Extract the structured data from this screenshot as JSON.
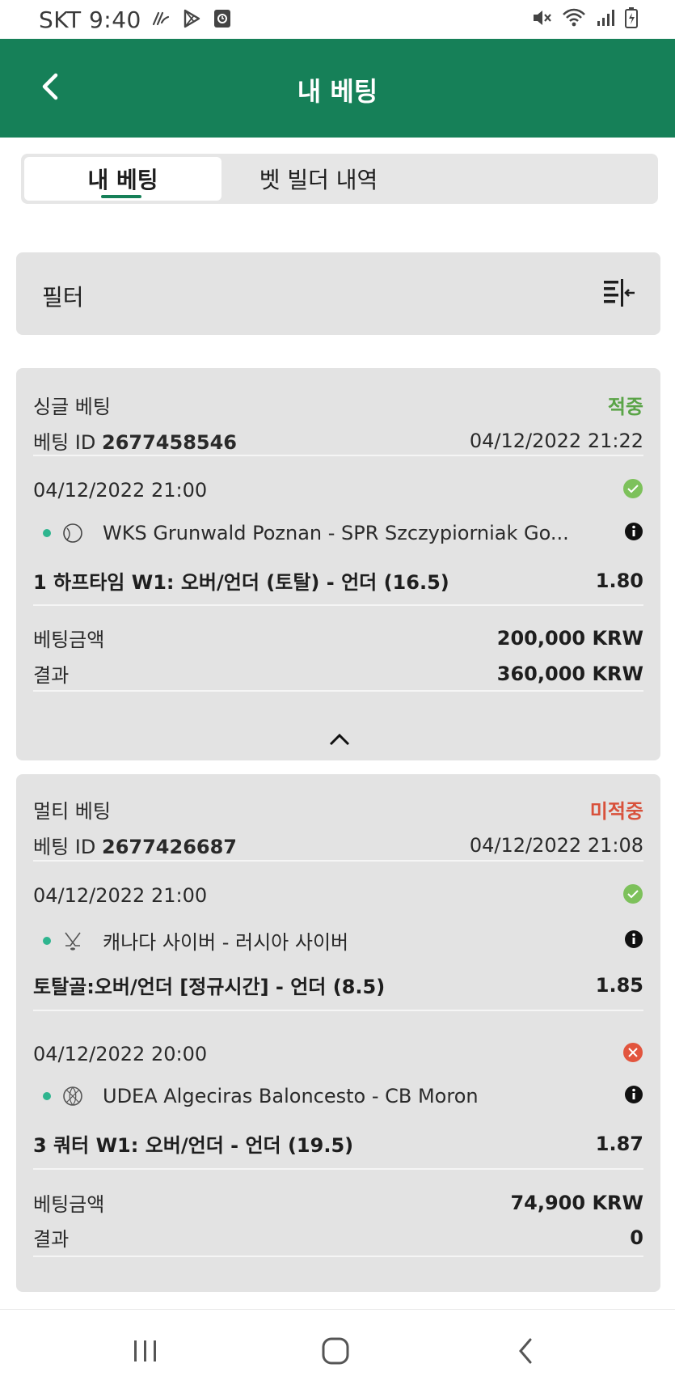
{
  "status_bar": {
    "time": "SKT 9:40"
  },
  "header": {
    "title": "내 베팅"
  },
  "tabs": [
    {
      "label": "내 베팅",
      "active": true
    },
    {
      "label": "벳 빌더 내역",
      "active": false
    }
  ],
  "filter": {
    "label": "필터",
    "icon": "filter-sort-icon"
  },
  "bets": [
    {
      "type": "싱글 베팅",
      "status": "적중",
      "status_color": "#5aa447",
      "id_label": "베팅 ID",
      "id": "2677458546",
      "placed_at": "04/12/2022 21:22",
      "selections": [
        {
          "date": "04/12/2022 21:00",
          "result_icon": "check-circle-icon",
          "sport_icon": "handball-icon",
          "event": "WKS Grunwald Poznan - SPR Szczypiorniak Go...",
          "market": "1 하프타임 W1: 오버/언더 (토탈) - 언더 (16.5)",
          "odds": "1.80"
        }
      ],
      "stake_label": "베팅금액",
      "stake": "200,000 KRW",
      "result_label": "결과",
      "result": "360,000 KRW"
    },
    {
      "type": "멀티 베팅",
      "status": "미적중",
      "status_color": "#d8513b",
      "id_label": "베팅 ID",
      "id": "2677426687",
      "placed_at": "04/12/2022 21:08",
      "selections": [
        {
          "date": "04/12/2022 21:00",
          "result_icon": "check-circle-icon",
          "sport_icon": "hockey-icon",
          "event": "캐나다 사이버 - 러시아 사이버",
          "market": "토탈골:오버/언더 [정규시간] - 언더 (8.5)",
          "odds": "1.85"
        },
        {
          "date": "04/12/2022 20:00",
          "result_icon": "x-circle-icon",
          "sport_icon": "basketball-icon",
          "event": "UDEA Algeciras Baloncesto - CB Moron",
          "market": "3 쿼터 W1: 오버/언더 - 언더 (19.5)",
          "odds": "1.87"
        }
      ],
      "stake_label": "베팅금액",
      "stake": "74,900 KRW",
      "result_label": "결과",
      "result": "0"
    }
  ],
  "colors": {
    "brand_green": "#168058",
    "won": "#5aa447",
    "lost": "#d8513b",
    "live_dot": "#2fb58f"
  }
}
